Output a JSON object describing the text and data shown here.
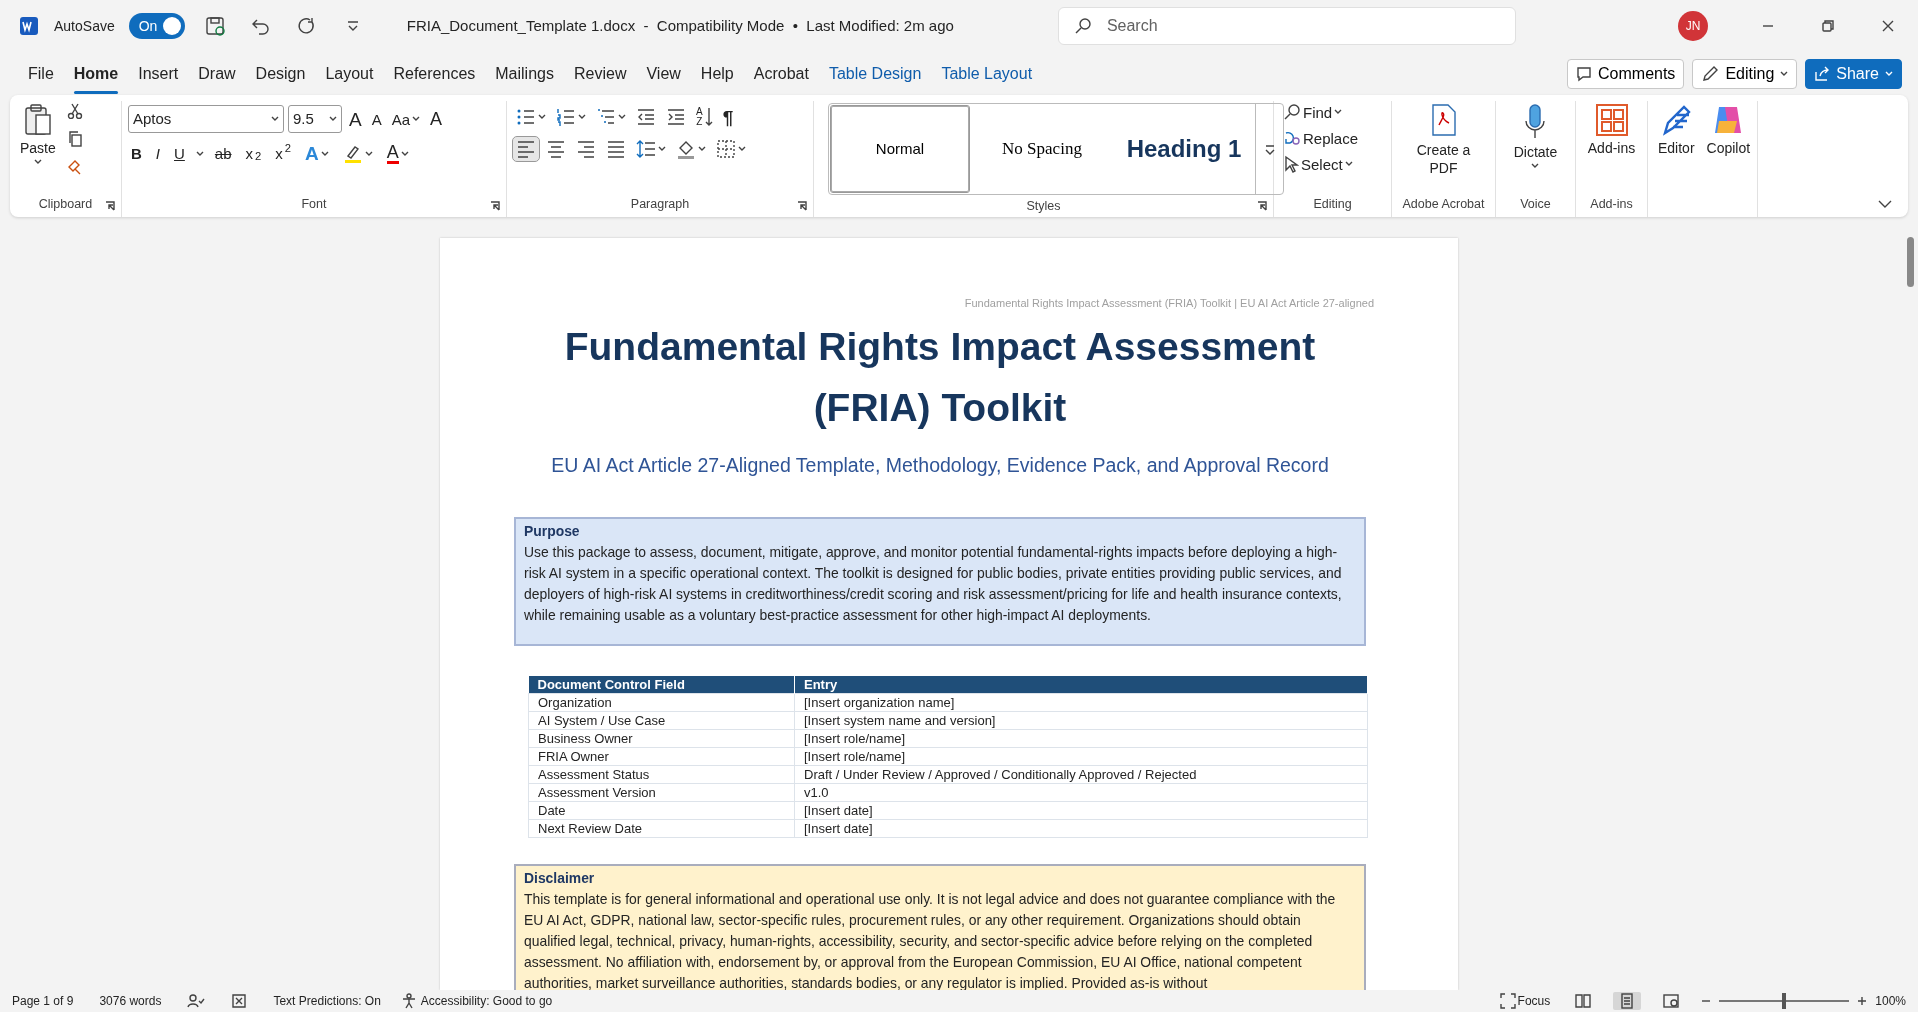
{
  "title_bar": {
    "autosave_label": "AutoSave",
    "autosave": {
      "on": true,
      "text": "On"
    },
    "document_title": "FRIA_Document_Template 1.docx  -  Compatibility Mode  •  Last Modified: 2m ago",
    "search": {
      "placeholder": "Search"
    },
    "user_initials": "JN"
  },
  "menu_tabs": [
    {
      "label": "File",
      "kind": "standard",
      "selected": false
    },
    {
      "label": "Home",
      "kind": "standard",
      "selected": true
    },
    {
      "label": "Insert",
      "kind": "standard",
      "selected": false
    },
    {
      "label": "Draw",
      "kind": "standard",
      "selected": false
    },
    {
      "label": "Design",
      "kind": "standard",
      "selected": false
    },
    {
      "label": "Layout",
      "kind": "standard",
      "selected": false
    },
    {
      "label": "References",
      "kind": "standard",
      "selected": false
    },
    {
      "label": "Mailings",
      "kind": "standard",
      "selected": false
    },
    {
      "label": "Review",
      "kind": "standard",
      "selected": false
    },
    {
      "label": "View",
      "kind": "standard",
      "selected": false
    },
    {
      "label": "Help",
      "kind": "standard",
      "selected": false
    },
    {
      "label": "Acrobat",
      "kind": "standard",
      "selected": false
    },
    {
      "label": "Table Design",
      "kind": "contextual",
      "selected": false
    },
    {
      "label": "Table Layout",
      "kind": "contextual",
      "selected": false
    }
  ],
  "header_buttons": {
    "comments": "Comments",
    "editing": "Editing",
    "share": "Share"
  },
  "ribbon": {
    "clipboard": {
      "paste": "Paste",
      "label": "Clipboard"
    },
    "font": {
      "font_name": "Aptos",
      "font_size": "9.5",
      "grow": "A",
      "shrink": "A",
      "change_case": "Aa",
      "clear_formatting": "A",
      "format_buttons": [
        "B",
        "I",
        "U",
        "ab",
        "x$_{2}$",
        "x$^{2}$"
      ],
      "text_effects": "A",
      "font_color": "A",
      "label": "Font"
    },
    "paragraph": {
      "sort": [
        "A",
        "Z"
      ],
      "show_marks": "¶",
      "alignment": [
        {
          "selected": true
        },
        {
          "selected": false
        },
        {
          "selected": false
        },
        {
          "selected": false
        }
      ],
      "label": "Paragraph"
    },
    "styles": {
      "items": [
        {
          "label": "Normal",
          "kind": "normal",
          "selected": true
        },
        {
          "label": "No Spacing",
          "kind": "no_spacing",
          "selected": false
        },
        {
          "label": "Heading 1",
          "kind": "heading",
          "selected": false
        }
      ],
      "label": "Styles"
    },
    "editing": {
      "find": "Find",
      "replace": "Replace",
      "select": "Select",
      "label": "Editing"
    },
    "acrobat": {
      "button": "Create a PDF",
      "label": "Adobe Acrobat"
    },
    "voice": {
      "button": "Dictate",
      "label": "Voice"
    },
    "addins": {
      "button": "Add-ins",
      "label": "Add-ins"
    },
    "extra_buttons": [
      {
        "label": "Editor",
        "kind": "editor"
      },
      {
        "label": "Copilot",
        "kind": "copilot"
      }
    ]
  },
  "document": {
    "running_header": "Fundamental Rights Impact Assessment (FRIA) Toolkit | EU AI Act Article 27-aligned",
    "title": "Fundamental Rights Impact Assessment (FRIA) Toolkit",
    "subtitle": "EU AI Act Article 27-Aligned Template, Methodology, Evidence Pack, and Approval Record",
    "purpose": {
      "heading": "Purpose",
      "text": "Use this package to assess, document, mitigate, approve, and monitor potential fundamental-rights impacts before deploying a high-risk AI system in a specific operational context. The toolkit is designed for public bodies, private entities providing public services, and deployers of high-risk AI systems in creditworthiness/credit scoring and risk assessment/pricing for life and health insurance contexts, while remaining usable as a voluntary best-practice assessment for other high-impact AI deployments."
    },
    "control_table": {
      "columns": [
        "Document Control Field",
        "Entry"
      ],
      "rows": [
        [
          "Organization",
          "[Insert organization name]"
        ],
        [
          "AI System / Use Case",
          "[Insert system name and version]"
        ],
        [
          "Business Owner",
          "[Insert role/name]"
        ],
        [
          "FRIA Owner",
          "[Insert role/name]"
        ],
        [
          "Assessment Status",
          "Draft / Under Review / Approved / Conditionally Approved / Rejected"
        ],
        [
          "Assessment Version",
          "v1.0"
        ],
        [
          "Date",
          "[Insert date]"
        ],
        [
          "Next Review Date",
          "[Insert date]"
        ]
      ]
    },
    "disclaimer": {
      "heading": "Disclaimer",
      "text": "This template is for general informational and operational use only. It is not legal advice and does not guarantee compliance with the EU AI Act, GDPR, national law, sector-specific rules, procurement rules, or any other requirement. Organizations should obtain qualified legal, technical, privacy, human-rights, accessibility, security, and sector-specific advice before relying on the completed assessment. No affiliation with, endorsement by, or approval from the European Commission, EU AI Office, national competent authorities, market surveillance authorities, standards bodies, or any regulator is implied. Provided as-is without"
    }
  },
  "status_bar": {
    "page": "Page 1 of 9",
    "words": "3076 words",
    "text_predictions": "Text Predictions: On",
    "accessibility": "Accessibility: Good to go",
    "focus": "Focus",
    "views": [
      {
        "selected": false
      },
      {
        "selected": true
      },
      {
        "selected": false
      }
    ],
    "zoom": {
      "level": 0.5,
      "reading": "100%"
    }
  }
}
